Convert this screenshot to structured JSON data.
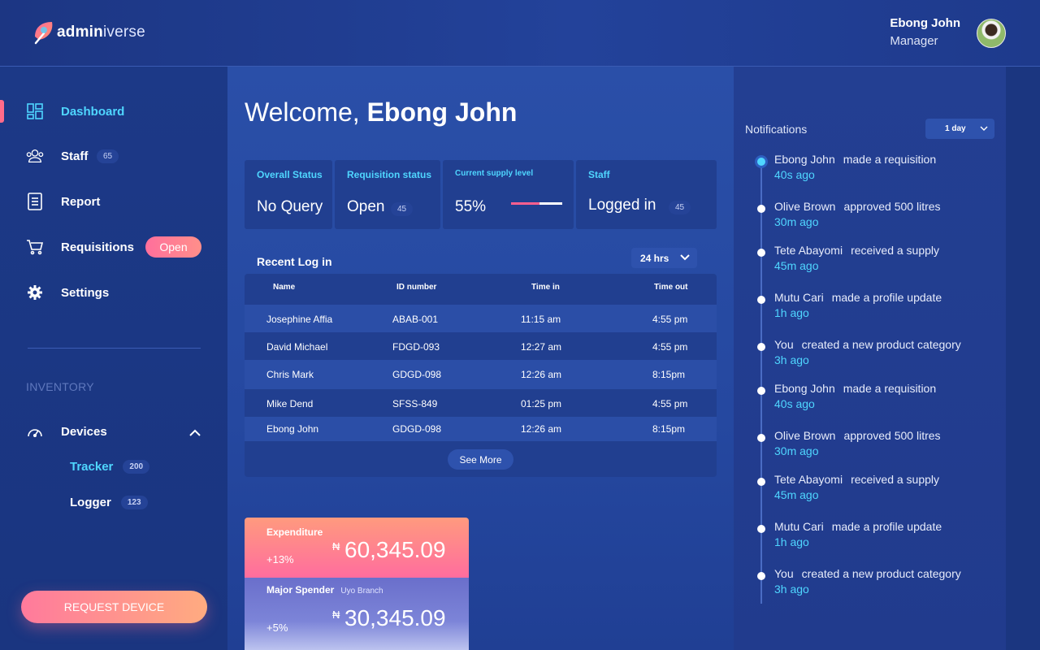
{
  "brand": {
    "name_bold": "admin",
    "name_light": "iverse"
  },
  "user": {
    "name": "Ebong John",
    "role": "Manager"
  },
  "sidebar": {
    "items": [
      {
        "label": "Dashboard"
      },
      {
        "label": "Staff",
        "count": "65"
      },
      {
        "label": "Report"
      },
      {
        "label": "Requisitions",
        "badge": "Open"
      },
      {
        "label": "Settings"
      }
    ],
    "section": "INVENTORY",
    "devices": {
      "label": "Devices"
    },
    "sub_items": [
      {
        "label": "Tracker",
        "count": "200"
      },
      {
        "label": "Logger",
        "count": "123"
      }
    ],
    "cta": "REQUEST DEVICE"
  },
  "welcome": {
    "greeting": "Welcome,",
    "name": "Ebong John"
  },
  "status": {
    "overall": {
      "title": "Overall Status",
      "value": "No Query"
    },
    "requisition": {
      "title": "Requisition status",
      "value": "Open",
      "count": "45"
    },
    "supply": {
      "title": "Current supply level",
      "value": "55%",
      "fraction": 0.55
    },
    "staff": {
      "title": "Staff",
      "value": "Logged in",
      "count": "45"
    }
  },
  "recent_login": {
    "title": "Recent Log in",
    "range": "24 hrs",
    "columns": [
      "Name",
      "ID number",
      "Time in",
      "Time out"
    ],
    "rows": [
      [
        "Josephine Affia",
        "ABAB-001",
        "11:15 am",
        "4:55 pm"
      ],
      [
        "David Michael",
        "FDGD-093",
        "12:27 am",
        "4:55 pm"
      ],
      [
        "Chris Mark",
        "GDGD-098",
        "12:26 am",
        "8:15pm"
      ],
      [
        "Mike Dend",
        "SFSS-849",
        "01:25 pm",
        "4:55 pm"
      ],
      [
        "Ebong John",
        "GDGD-098",
        "12:26 am",
        "8:15pm"
      ]
    ],
    "see_more": "See More"
  },
  "expenditure": {
    "label": "Expenditure",
    "change": "+13%",
    "currency": "₦",
    "value": "60,345.09"
  },
  "major_spender": {
    "label": "Major Spender",
    "branch": "Uyo Branch",
    "change": "+5%",
    "currency": "₦",
    "value": "30,345.09"
  },
  "notifications": {
    "title": "Notifications",
    "range": "1 day",
    "items": [
      {
        "who": "Ebong John",
        "what": "made a requisition",
        "time": "40s ago"
      },
      {
        "who": "Olive Brown",
        "what": "approved 500 litres",
        "time": "30m ago"
      },
      {
        "who": "Tete Abayomi",
        "what": "received a supply",
        "time": "45m ago"
      },
      {
        "who": "Mutu Cari",
        "what": "made a profile update",
        "time": "1h ago"
      },
      {
        "who": "You",
        "what": "created a new product category",
        "time": "3h ago"
      },
      {
        "who": "Ebong John",
        "what": "made a requisition",
        "time": "40s ago"
      },
      {
        "who": "Olive Brown",
        "what": "approved 500 litres",
        "time": "30m ago"
      },
      {
        "who": "Tete Abayomi",
        "what": "received a supply",
        "time": "45m ago"
      },
      {
        "who": "Mutu Cari",
        "what": "made a profile update",
        "time": "1h ago"
      },
      {
        "who": "You",
        "what": "created a new product category",
        "time": "3h ago"
      }
    ]
  },
  "colors": {
    "accent": "#4fd6ff",
    "pink": "#ff6b8a",
    "navy": "#1f3a8a"
  }
}
